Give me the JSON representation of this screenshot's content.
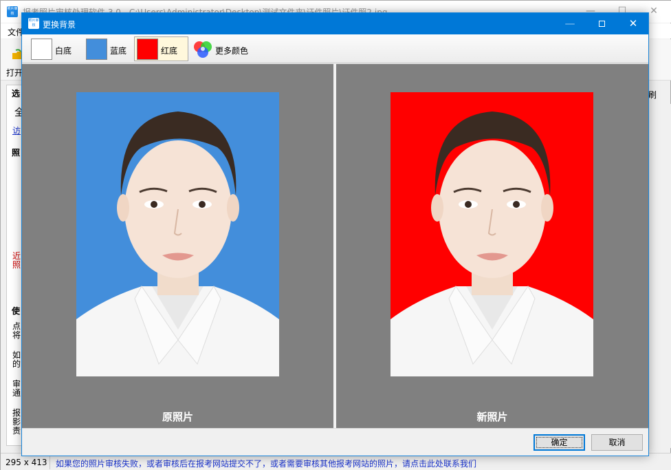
{
  "main_window": {
    "title": "报考照片审核处理软件 3.0 - C:\\Users\\Administrator\\Desktop\\测试文件夹\\证件照片\\证件照2.jpg",
    "icon_text": "照片审核",
    "menu_file": "文件",
    "open_label": "打开",
    "frag_xuan": "选",
    "frag_quan": "全",
    "frag_link": "访",
    "frag_zhao": "照",
    "frag_red1": "近",
    "frag_red2": "照",
    "frag_shi": "使",
    "frag_dian": "点",
    "frag_jiang": "将",
    "frag_ru": "如",
    "frag_de": "的",
    "frag_shen": "审",
    "frag_tong": "通",
    "frag_bao": "报",
    "frag_ying": "影",
    "frag_ze": "责",
    "right_label": "刷",
    "status_size": "295 x 413",
    "status_link": "如果您的照片审核失败，或者审核后在报考网站提交不了，或者需要审核其他报考网站的照片，请点击此处联系我们"
  },
  "dialog": {
    "title": "更换背景",
    "icon_text": "照片审核",
    "options": [
      {
        "label": "白底",
        "color": "#ffffff"
      },
      {
        "label": "蓝底",
        "color": "#438edb"
      },
      {
        "label": "红底",
        "color": "#ff0000"
      }
    ],
    "more_colors_label": "更多颜色",
    "selected_option": "红底",
    "original_label": "原照片",
    "new_label": "新照片",
    "original_bg": "#438edb",
    "new_bg": "#ff0000",
    "ok_label": "确定",
    "cancel_label": "取消"
  }
}
